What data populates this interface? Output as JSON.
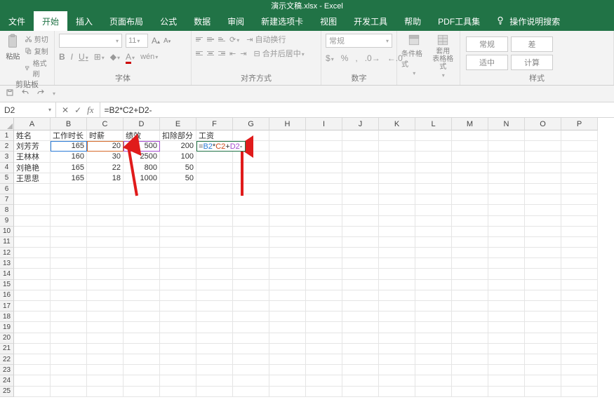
{
  "title": "演示文稿.xlsx - Excel",
  "tabs": [
    "文件",
    "开始",
    "插入",
    "页面布局",
    "公式",
    "数据",
    "审阅",
    "新建选项卡",
    "视图",
    "开发工具",
    "帮助",
    "PDF工具集"
  ],
  "active_tab_index": 1,
  "tell_me": "操作说明搜索",
  "clipboard": {
    "paste": "粘贴",
    "cut": "剪切",
    "copy": "复制",
    "format_painter": "格式刷",
    "label": "剪贴板"
  },
  "font": {
    "size": "11",
    "bold": "B",
    "italic": "I",
    "underline": "U",
    "label": "字体",
    "increase": "A",
    "decrease": "A"
  },
  "alignment": {
    "wrap": "自动换行",
    "merge": "合并后居中",
    "label": "对齐方式"
  },
  "number": {
    "select": "常规",
    "label": "数字"
  },
  "cond_format": "条件格式",
  "table_format": "套用\n表格格式",
  "style_boxes": [
    "常规",
    "差",
    "适中",
    "计算"
  ],
  "styles_label": "样式",
  "name_box": "D2",
  "formula": "=B2*C2+D2-",
  "columns": [
    "A",
    "B",
    "C",
    "D",
    "E",
    "F",
    "G",
    "H",
    "I",
    "J",
    "K",
    "L",
    "M",
    "N",
    "O",
    "P"
  ],
  "rows_shown": 25,
  "headers_row": [
    "姓名",
    "工作时长",
    "时薪",
    "绩效",
    "扣除部分",
    "工资"
  ],
  "data_rows": [
    {
      "name": "刘芳芳",
      "hours": 165,
      "rate": 20,
      "perf": 500,
      "deduct": 200
    },
    {
      "name": "王林林",
      "hours": 160,
      "rate": 30,
      "perf": 2500,
      "deduct": 100
    },
    {
      "name": "刘艳艳",
      "hours": 165,
      "rate": 22,
      "perf": 800,
      "deduct": 50
    },
    {
      "name": "王思思",
      "hours": 165,
      "rate": 18,
      "perf": 1000,
      "deduct": 50
    }
  ],
  "editing_formula_parts": {
    "eq": "=",
    "b": "B2",
    "m": "*",
    "c": "C2",
    "p": "+",
    "d": "D2",
    "t": "-"
  }
}
